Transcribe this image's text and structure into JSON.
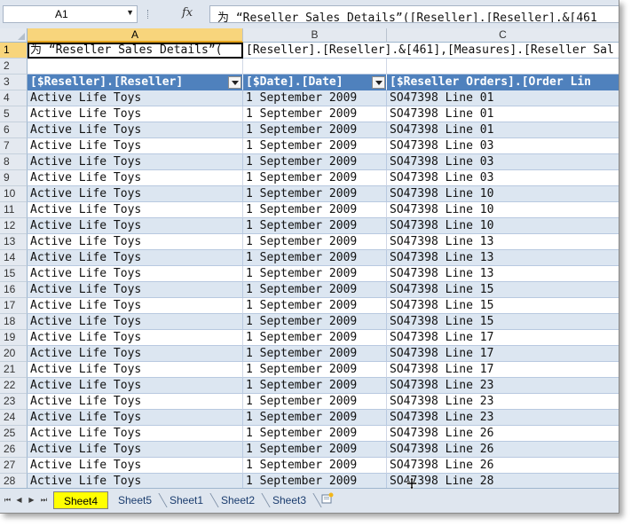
{
  "formula_bar": {
    "name_box": "A1",
    "fx_label": "fx",
    "formula_text": "为 “Reseller Sales Details”([Reseller].[Reseller].&[461"
  },
  "columns": [
    "A",
    "B",
    "C"
  ],
  "selected_column": "A",
  "rows": {
    "row1": {
      "num": "1",
      "a": "为 “Reseller Sales Details”(",
      "bc": "[Reseller].[Reseller].&[461],[Measures].[Reseller Sal"
    },
    "row2": {
      "num": "2"
    },
    "row3": {
      "num": "3",
      "a": "[$Reseller].[Reseller]",
      "b": "[$Date].[Date]",
      "c": "[$Reseller Orders].[Order Lin"
    }
  },
  "data_rows": [
    {
      "num": "4",
      "reseller": "Active Life Toys",
      "date": "1 September 2009",
      "order": "SO47398 Line 01"
    },
    {
      "num": "5",
      "reseller": "Active Life Toys",
      "date": "1 September 2009",
      "order": "SO47398 Line 01"
    },
    {
      "num": "6",
      "reseller": "Active Life Toys",
      "date": "1 September 2009",
      "order": "SO47398 Line 01"
    },
    {
      "num": "7",
      "reseller": "Active Life Toys",
      "date": "1 September 2009",
      "order": "SO47398 Line 03"
    },
    {
      "num": "8",
      "reseller": "Active Life Toys",
      "date": "1 September 2009",
      "order": "SO47398 Line 03"
    },
    {
      "num": "9",
      "reseller": "Active Life Toys",
      "date": "1 September 2009",
      "order": "SO47398 Line 03"
    },
    {
      "num": "10",
      "reseller": "Active Life Toys",
      "date": "1 September 2009",
      "order": "SO47398 Line 10"
    },
    {
      "num": "11",
      "reseller": "Active Life Toys",
      "date": "1 September 2009",
      "order": "SO47398 Line 10"
    },
    {
      "num": "12",
      "reseller": "Active Life Toys",
      "date": "1 September 2009",
      "order": "SO47398 Line 10"
    },
    {
      "num": "13",
      "reseller": "Active Life Toys",
      "date": "1 September 2009",
      "order": "SO47398 Line 13"
    },
    {
      "num": "14",
      "reseller": "Active Life Toys",
      "date": "1 September 2009",
      "order": "SO47398 Line 13"
    },
    {
      "num": "15",
      "reseller": "Active Life Toys",
      "date": "1 September 2009",
      "order": "SO47398 Line 13"
    },
    {
      "num": "16",
      "reseller": "Active Life Toys",
      "date": "1 September 2009",
      "order": "SO47398 Line 15"
    },
    {
      "num": "17",
      "reseller": "Active Life Toys",
      "date": "1 September 2009",
      "order": "SO47398 Line 15"
    },
    {
      "num": "18",
      "reseller": "Active Life Toys",
      "date": "1 September 2009",
      "order": "SO47398 Line 15"
    },
    {
      "num": "19",
      "reseller": "Active Life Toys",
      "date": "1 September 2009",
      "order": "SO47398 Line 17"
    },
    {
      "num": "20",
      "reseller": "Active Life Toys",
      "date": "1 September 2009",
      "order": "SO47398 Line 17"
    },
    {
      "num": "21",
      "reseller": "Active Life Toys",
      "date": "1 September 2009",
      "order": "SO47398 Line 17"
    },
    {
      "num": "22",
      "reseller": "Active Life Toys",
      "date": "1 September 2009",
      "order": "SO47398 Line 23"
    },
    {
      "num": "23",
      "reseller": "Active Life Toys",
      "date": "1 September 2009",
      "order": "SO47398 Line 23"
    },
    {
      "num": "24",
      "reseller": "Active Life Toys",
      "date": "1 September 2009",
      "order": "SO47398 Line 23"
    },
    {
      "num": "25",
      "reseller": "Active Life Toys",
      "date": "1 September 2009",
      "order": "SO47398 Line 26"
    },
    {
      "num": "26",
      "reseller": "Active Life Toys",
      "date": "1 September 2009",
      "order": "SO47398 Line 26"
    },
    {
      "num": "27",
      "reseller": "Active Life Toys",
      "date": "1 September 2009",
      "order": "SO47398 Line 26"
    },
    {
      "num": "28",
      "reseller": "Active Life Toys",
      "date": "1 September 2009",
      "order": "SO47398 Line 28"
    }
  ],
  "sheet_tabs": [
    {
      "label": "Sheet4",
      "active": true
    },
    {
      "label": "Sheet5",
      "active": false
    },
    {
      "label": "Sheet1",
      "active": false
    },
    {
      "label": "Sheet2",
      "active": false
    },
    {
      "label": "Sheet3",
      "active": false
    }
  ],
  "colors": {
    "header_blue": "#4f81bd",
    "band_light": "#dce6f1",
    "active_tab": "#ffff00",
    "selected_heading": "#f8d57c"
  }
}
